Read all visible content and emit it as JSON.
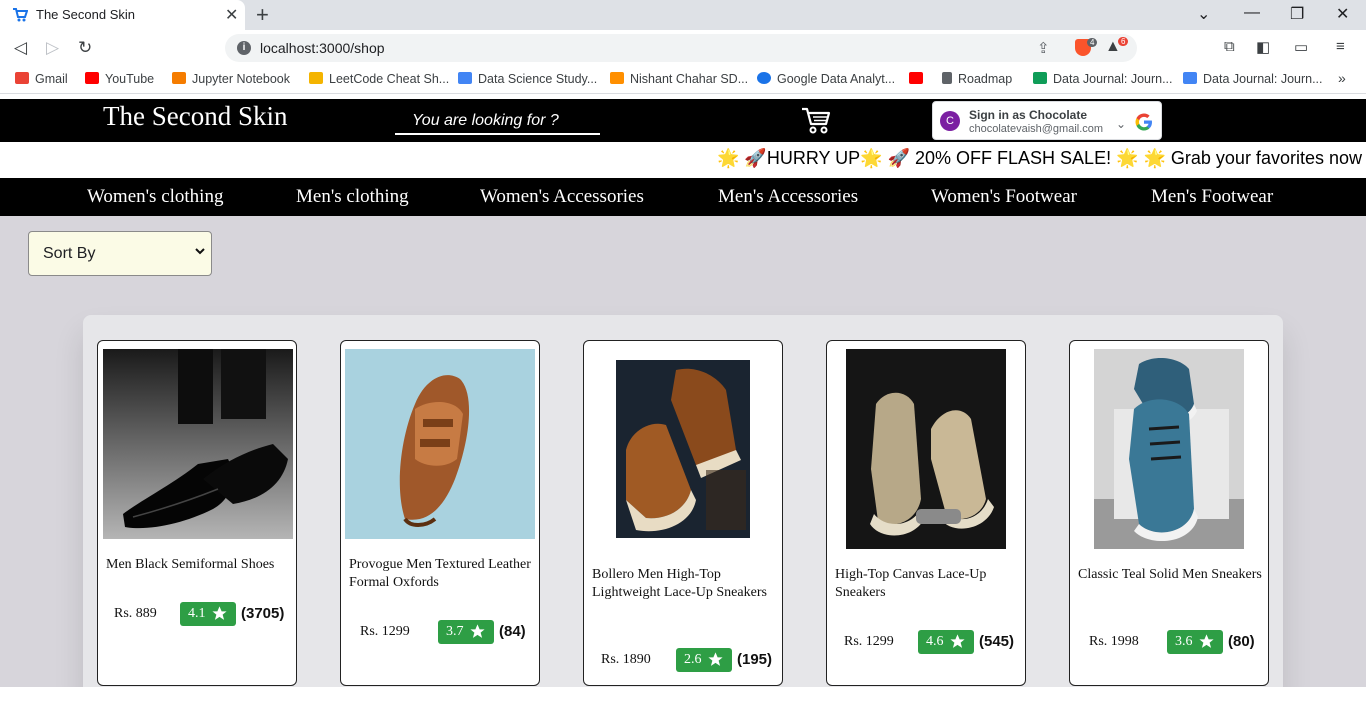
{
  "browser": {
    "tab_title": "The Second Skin",
    "url": "localhost:3000/shop",
    "brave_badge": "4",
    "alert_badge": "6",
    "bookmarks": [
      {
        "label": "Gmail",
        "color": "#ea4335"
      },
      {
        "label": "YouTube",
        "color": "#ff0000"
      },
      {
        "label": "Jupyter Notebook",
        "color": "#f57c00"
      },
      {
        "label": "LeetCode Cheat Sh...",
        "color": "#f4b400"
      },
      {
        "label": "Data Science Study...",
        "color": "#4285f4"
      },
      {
        "label": "Nishant Chahar SD...",
        "color": "#ff8f00"
      },
      {
        "label": "Google Data Analyt...",
        "color": "#1a73e8"
      },
      {
        "label": "",
        "color": "#ff0000"
      },
      {
        "label": "Roadmap",
        "color": "#5f6368"
      },
      {
        "label": "Data Journal: Journ...",
        "color": "#0f9d58"
      },
      {
        "label": "Data Journal: Journ...",
        "color": "#4285f4"
      }
    ]
  },
  "header": {
    "brand": "The Second Skin",
    "search_placeholder": "You are looking for ?",
    "google": {
      "avatar_letter": "C",
      "sign_in": "Sign in as Chocolate",
      "email": "chocolatevaish@gmail.com"
    }
  },
  "promo": {
    "text": "🌟 🚀HURRY UP🌟 🚀 20% OFF FLASH SALE! 🌟 🌟 Grab your favorites now"
  },
  "categories": [
    "Women's clothing",
    "Men's clothing",
    "Women's Accessories",
    "Men's Accessories",
    "Women's Footwear",
    "Men's Footwear"
  ],
  "sort": {
    "label": "Sort By"
  },
  "products": [
    {
      "name": "Men Black Semiformal Shoes",
      "price": "Rs. 889",
      "rating": "4.1",
      "count": "(3705)"
    },
    {
      "name": "Provogue Men Textured Leather Formal Oxfords",
      "price": "Rs. 1299",
      "rating": "3.7",
      "count": "(84)"
    },
    {
      "name": "Bollero Men High-Top Lightweight Lace-Up Sneakers",
      "price": "Rs. 1890",
      "rating": "2.6",
      "count": "(195)"
    },
    {
      "name": "High-Top Canvas Lace-Up Sneakers",
      "price": "Rs. 1299",
      "rating": "4.6",
      "count": "(545)"
    },
    {
      "name": "Classic Teal Solid Men Sneakers",
      "price": "Rs. 1998",
      "rating": "3.6",
      "count": "(80)"
    }
  ],
  "colors": {
    "rating_green": "#2e9e45",
    "header_black": "#000000",
    "page_gray": "#d7d5db"
  }
}
